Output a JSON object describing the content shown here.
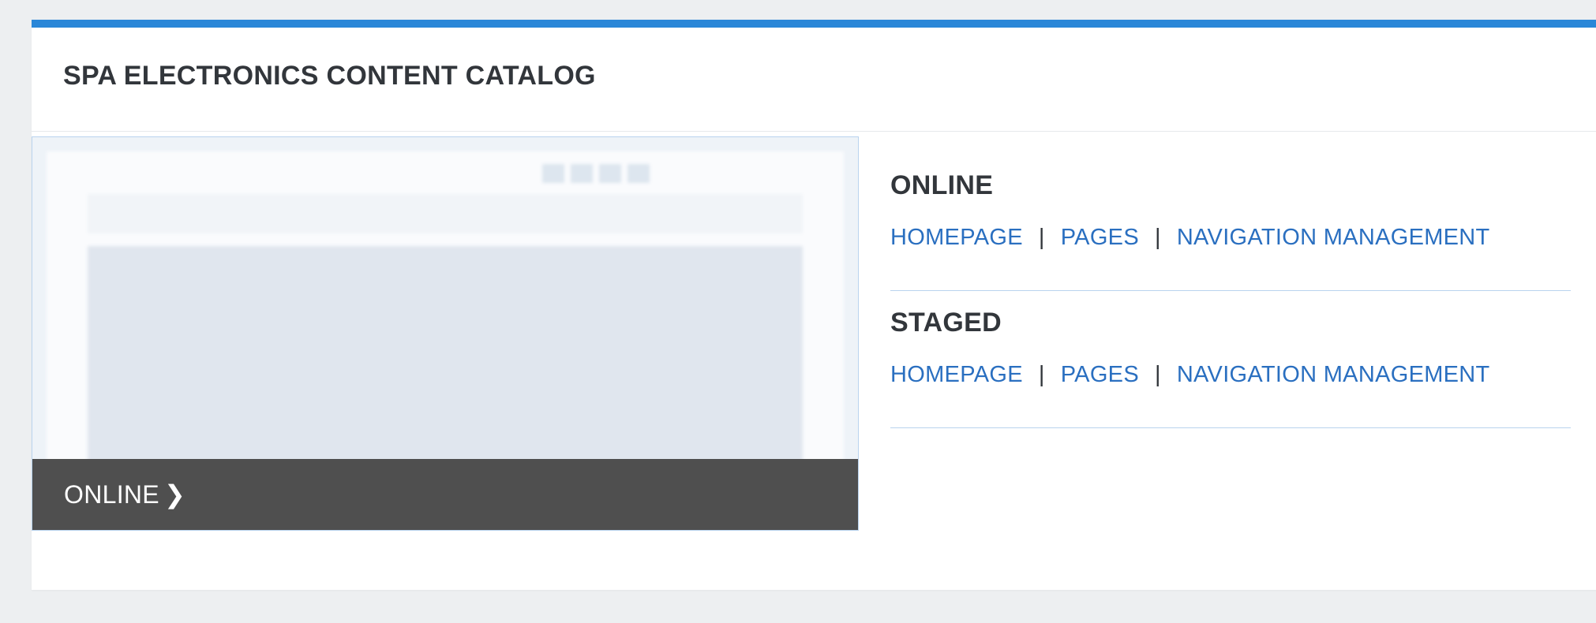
{
  "catalog": {
    "title": "SPA ELECTRONICS CONTENT CATALOG"
  },
  "preview": {
    "caption": "ONLINE",
    "caption_icon": "chevron-right-icon",
    "caption_chevron": "❯"
  },
  "versions": [
    {
      "title": "ONLINE",
      "links": [
        "HOMEPAGE",
        "PAGES",
        "NAVIGATION MANAGEMENT"
      ]
    },
    {
      "title": "STAGED",
      "links": [
        "HOMEPAGE",
        "PAGES",
        "NAVIGATION MANAGEMENT"
      ]
    }
  ],
  "separator": "|",
  "colors": {
    "accent_bar": "#2a87d8",
    "link": "#2a6fc0",
    "title_text": "#32363b",
    "caption_bg": "#4f4f4f",
    "page_bg": "#edeff1"
  }
}
